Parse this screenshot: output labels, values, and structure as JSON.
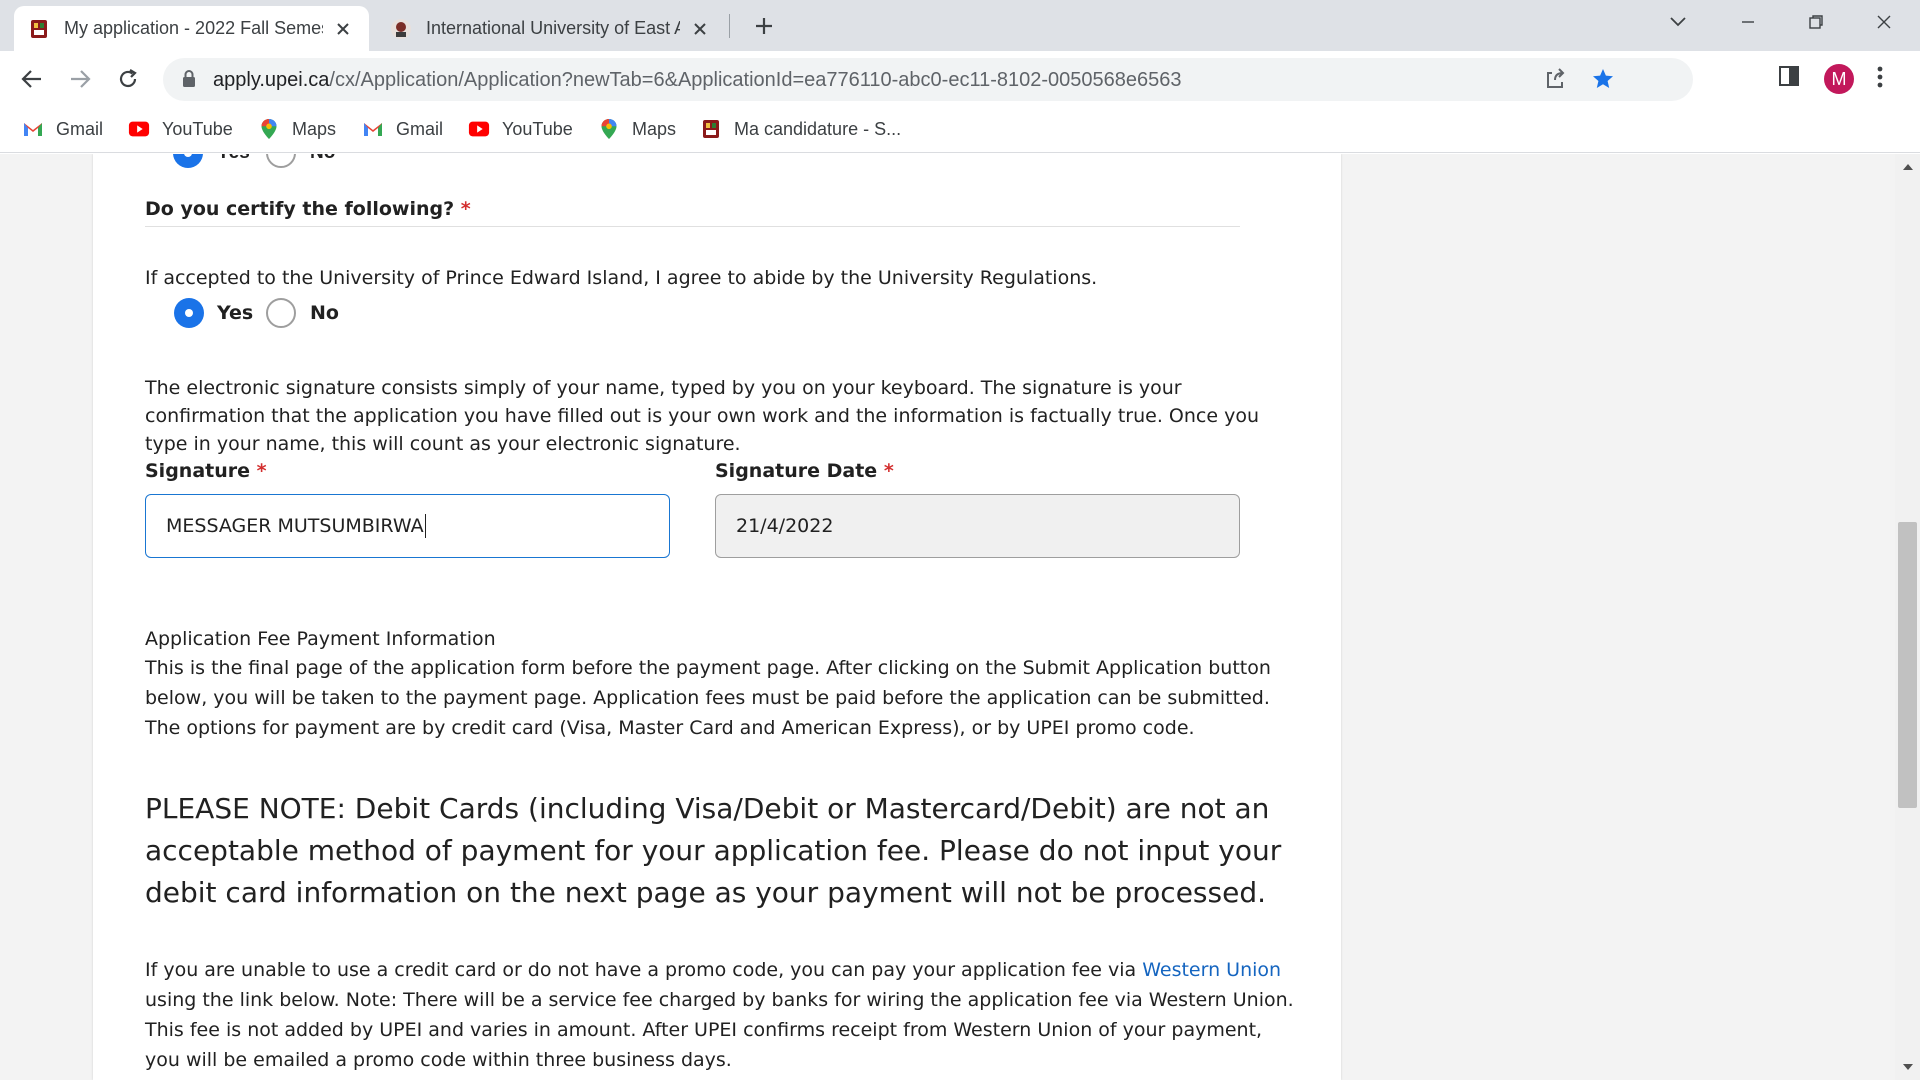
{
  "browser": {
    "tabs": [
      {
        "title": "My application - 2022 Fall Semes",
        "active": true
      },
      {
        "title": "International University of East Af",
        "active": false
      }
    ],
    "url_host": "apply.upei.ca",
    "url_path": "/cx/Application/Application?newTab=6&ApplicationId=ea776110-abc0-ec11-8102-0050568e6563",
    "avatar_letter": "M",
    "bookmarks": [
      {
        "label": "Gmail",
        "icon": "gmail-icon"
      },
      {
        "label": "YouTube",
        "icon": "youtube-icon"
      },
      {
        "label": "Maps",
        "icon": "maps-icon"
      },
      {
        "label": "Gmail",
        "icon": "gmail-icon"
      },
      {
        "label": "YouTube",
        "icon": "youtube-icon"
      },
      {
        "label": "Maps",
        "icon": "maps-icon"
      },
      {
        "label": "Ma candidature - S...",
        "icon": "upei-crest-icon"
      }
    ],
    "accent": "#1a73e8"
  },
  "form": {
    "top_partial": {
      "yes": "Yes",
      "no": "No"
    },
    "certify": {
      "title": "Do you certify the following?",
      "required_mark": "*",
      "statement": "If accepted to the University of Prince Edward Island, I agree to abide by the University Regulations.",
      "yes": "Yes",
      "no": "No",
      "selected": "Yes"
    },
    "signature": {
      "description": "The electronic signature consists simply of your name, typed by you on your keyboard. The signature is your confirmation that the application you have filled out is your own work and the information is factually true. Once you type in your name, this will count as your electronic signature.",
      "label": "Signature",
      "required_mark": "*",
      "value": "MESSAGER MUTSUMBIRWA",
      "date_label": "Signature Date",
      "date_required_mark": "*",
      "date_value": "21/4/2022"
    },
    "fee": {
      "heading": "Application Fee Payment Information",
      "body": "This is the final page of the application form before the payment page. After clicking on the Submit Application button below, you will be taken to the payment page. Application fees must be paid before the application can be submitted. The options for payment are by credit card (Visa, Master Card and American Express), or by UPEI promo code.",
      "note": "PLEASE NOTE: Debit Cards (including Visa/Debit or Mastercard/Debit) are not an acceptable method of payment for your application fee. Please do not input your debit card information on the next page as your payment will not be processed.",
      "wu_before": "If you are unable to use a credit card or do not have a promo code, you can pay your application fee via ",
      "wu_link": "Western Union",
      "wu_after": " using the link below. Note: There will be a service fee charged by banks for wiring the application fee via Western Union. This fee is not added by UPEI and varies in amount. After UPEI confirms receipt from Western Union of your payment, you will be emailed a promo code within three business days."
    }
  }
}
